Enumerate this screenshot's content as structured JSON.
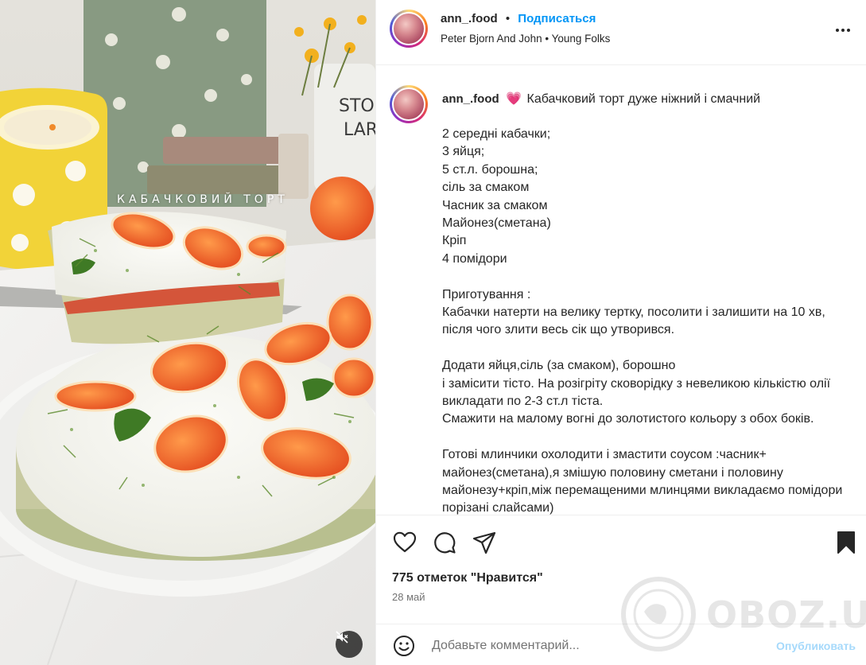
{
  "photo": {
    "overlay_text": "КАБАЧКОВИЙ ТОРТ",
    "mute_icon": "speaker-muted-icon"
  },
  "header": {
    "username": "ann_.food",
    "separator": "•",
    "follow_label": "Подписаться",
    "audio_artist": "Peter Bjorn And John",
    "audio_separator": "•",
    "audio_track": "Young Folks",
    "more_icon": "more-options-icon"
  },
  "caption": {
    "username": "ann_.food",
    "emoji": "💗",
    "first_line": "Кабачковий торт дуже ніжний і смачний",
    "paragraphs": [
      "2 середні кабачки;\n3 яйця;\n5 ст.л. борошна;\nсіль за смаком\nЧасник за смаком\nМайонез(сметана)\nКріп\n4 помідори",
      "Приготування :\nКабачки натерти на велику тертку, посолити і залишити на 10 хв, після чого злити весь сік що утворився.",
      "Додати яйця,сіль (за смаком), борошно\nі замісити тісто. На розігріту сковорідку з невеликою кількістю олії викладати по 2-3 ст.л тіста.\nСмажити на малому вогні до золотистого кольору з обох боків.",
      "Готові млинчики охолодити і змастити соусом :часник+ майонез(сметана),я змішую половину сметани і половину майонезу+кріп,між перемащеними млинцями викладаємо помідори порізані слайсами)"
    ]
  },
  "actions": {
    "like_icon": "heart-icon",
    "comment_icon": "comment-icon",
    "share_icon": "share-icon",
    "save_icon": "bookmark-icon"
  },
  "likes_text": "775 отметок \"Нравится\"",
  "date_text": "28 май",
  "comment": {
    "emoji_icon": "emoji-icon",
    "placeholder": "Добавьте комментарий...",
    "publish_label": "Опубликовать"
  },
  "watermark": {
    "text": "OBOZ.UA"
  },
  "colors": {
    "accent": "#0095f6",
    "text": "#262626",
    "muted": "#737373",
    "border": "#efefef"
  }
}
